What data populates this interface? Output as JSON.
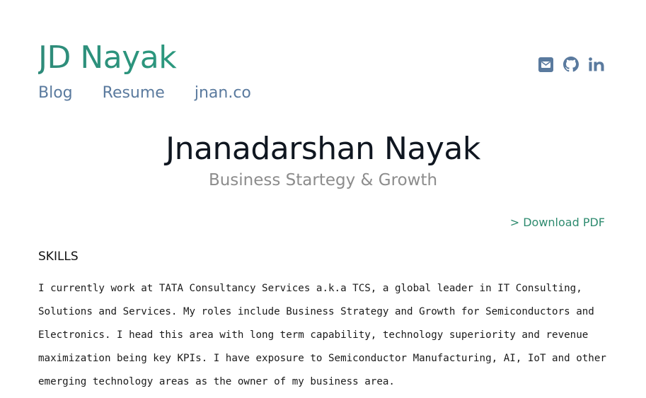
{
  "header": {
    "site_title": "JD Nayak",
    "nav": [
      "Blog",
      "Resume",
      "jnan.co"
    ]
  },
  "social": [
    {
      "icon": "envelope-icon",
      "label": "email"
    },
    {
      "icon": "github-icon",
      "label": "github"
    },
    {
      "icon": "linkedin-icon",
      "label": "in"
    }
  ],
  "hero": {
    "name": "Jnanadarshan Nayak",
    "tagline": "Business Startegy & Growth"
  },
  "download_label": "> Download PDF",
  "skills": {
    "heading": "SKILLS",
    "body": "I currently work at TATA Consultancy Services a.k.a TCS, a global leader in IT Consulting, Solutions and Services. My roles include Business Strategy and Growth for Semiconductors and Electronics. I head this area with long term capability, technology superiority and revenue maximization being key KPIs. I have exposure to Semiconductor Manufacturing, AI, IoT and other emerging technology areas as the owner of my business area."
  },
  "colors": {
    "brand": "#2a9d8f",
    "nav": "#5a7a9e",
    "icon": "#5a7a9e",
    "download": "#2e8b6f"
  }
}
